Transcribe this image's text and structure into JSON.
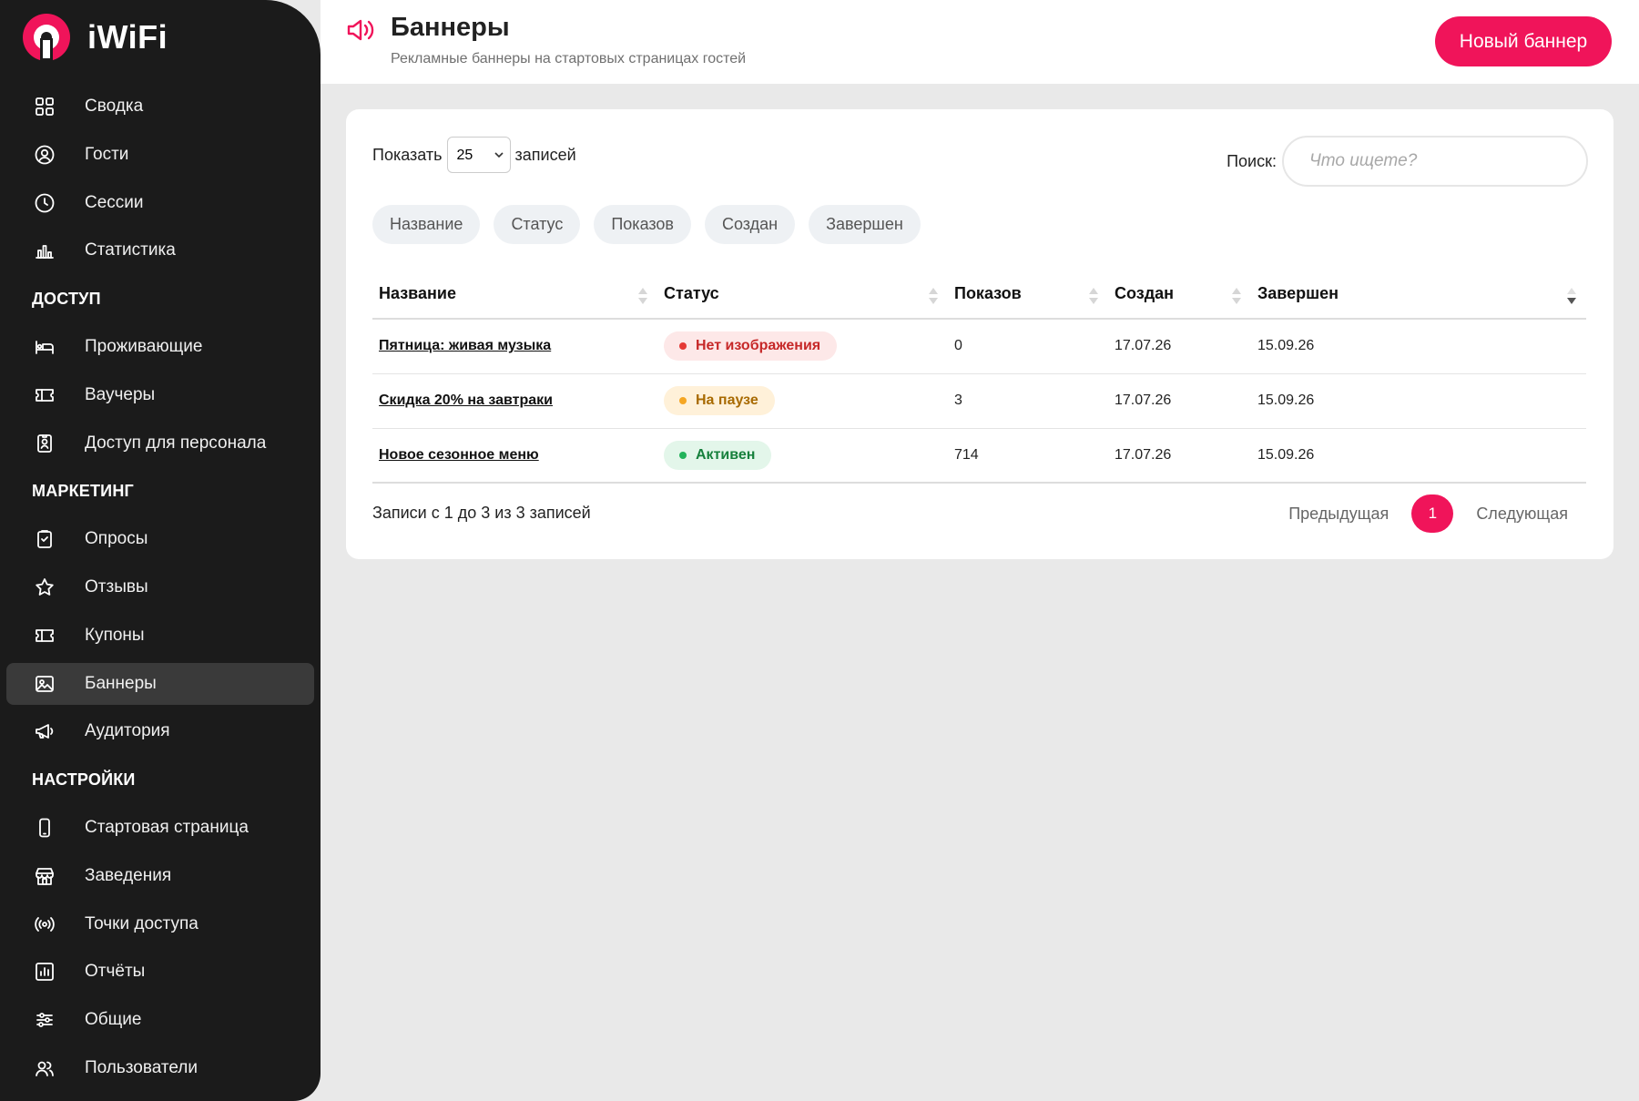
{
  "app": {
    "name": "iWiFi"
  },
  "colors": {
    "accent": "#f0145a",
    "sidebar_bg": "#1b1b1b"
  },
  "sidebar": {
    "groups": [
      {
        "section": "",
        "items": [
          {
            "label": "Сводка",
            "icon": "dashboard-icon"
          },
          {
            "label": "Гости",
            "icon": "user-circle-icon"
          },
          {
            "label": "Сессии",
            "icon": "clock-icon"
          },
          {
            "label": "Статистика",
            "icon": "bar-chart-icon"
          }
        ]
      },
      {
        "section": "ДОСТУП",
        "items": [
          {
            "label": "Проживающие",
            "icon": "bed-icon"
          },
          {
            "label": "Ваучеры",
            "icon": "ticket-icon"
          },
          {
            "label": "Доступ для персонала",
            "icon": "badge-icon"
          }
        ]
      },
      {
        "section": "МАРКЕТИНГ",
        "items": [
          {
            "label": "Опросы",
            "icon": "clipboard-icon"
          },
          {
            "label": "Отзывы",
            "icon": "star-icon"
          },
          {
            "label": "Купоны",
            "icon": "ticket-icon"
          },
          {
            "label": "Баннеры",
            "icon": "image-icon",
            "active": true
          },
          {
            "label": "Аудитория",
            "icon": "megaphone-icon"
          }
        ]
      },
      {
        "section": "НАСТРОЙКИ",
        "items": [
          {
            "label": "Стартовая страница",
            "icon": "phone-icon"
          },
          {
            "label": "Заведения",
            "icon": "store-icon"
          },
          {
            "label": "Точки доступа",
            "icon": "broadcast-icon"
          },
          {
            "label": "Отчёты",
            "icon": "report-icon"
          },
          {
            "label": "Общие",
            "icon": "sliders-icon"
          },
          {
            "label": "Пользователи",
            "icon": "users-icon"
          }
        ]
      }
    ]
  },
  "header": {
    "title": "Баннеры",
    "subtitle": "Рекламные баннеры на стартовых страницах гостей",
    "new_button": "Новый баннер"
  },
  "controls": {
    "show_label": "Показать",
    "page_size": "25",
    "entries_label": "записей",
    "search_label": "Поиск:",
    "search_placeholder": "Что ищете?"
  },
  "column_toggles": [
    "Название",
    "Статус",
    "Показов",
    "Создан",
    "Завершен"
  ],
  "table": {
    "columns": [
      "Название",
      "Статус",
      "Показов",
      "Создан",
      "Завершен"
    ],
    "rows": [
      {
        "name": "Пятница: живая музыка",
        "status": "Нет изображения",
        "status_type": "error",
        "views": "0",
        "created": "17.07.26",
        "ended": "15.09.26"
      },
      {
        "name": "Скидка 20% на завтраки",
        "status": "На паузе",
        "status_type": "paused",
        "views": "3",
        "created": "17.07.26",
        "ended": "15.09.26"
      },
      {
        "name": "Новое сезонное меню",
        "status": "Активен",
        "status_type": "active",
        "views": "714",
        "created": "17.07.26",
        "ended": "15.09.26"
      }
    ]
  },
  "status_colors": {
    "error": {
      "bg": "#fde8e8",
      "fg": "#c62828",
      "dot": "#e53935"
    },
    "paused": {
      "bg": "#fff1d9",
      "fg": "#a86a00",
      "dot": "#f5a623"
    },
    "active": {
      "bg": "#e3f6ea",
      "fg": "#16803c",
      "dot": "#22b35a"
    }
  },
  "footer": {
    "info": "Записи с 1 до 3 из 3 записей",
    "prev": "Предыдущая",
    "page": "1",
    "next": "Следующая"
  }
}
